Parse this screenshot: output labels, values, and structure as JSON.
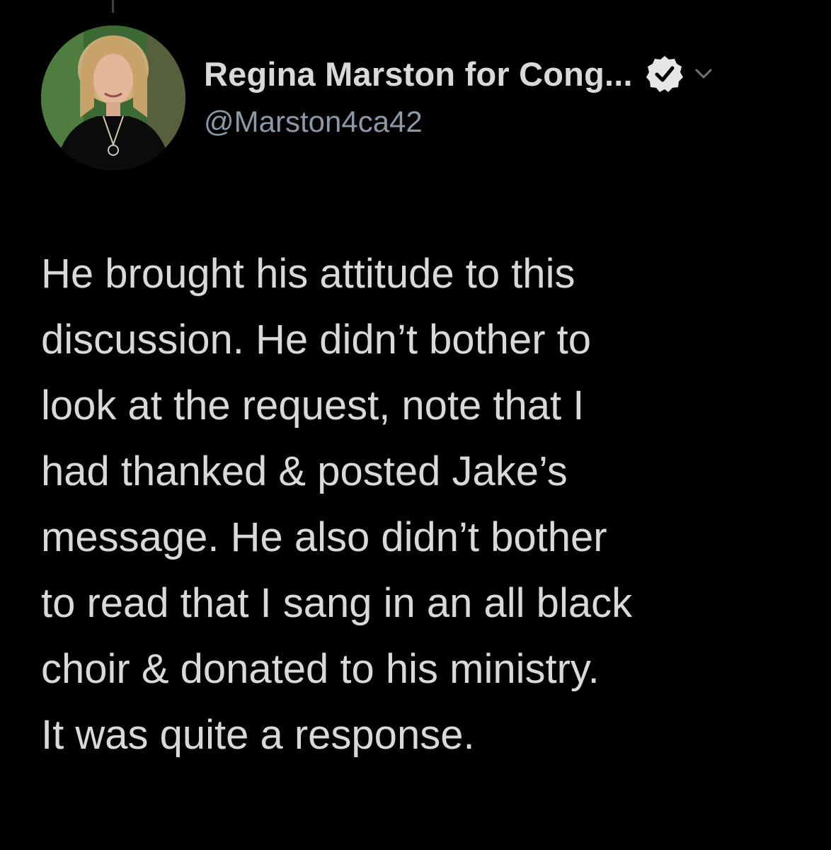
{
  "tweet": {
    "author": {
      "display_name": "Regina Marston for Cong...",
      "handle": "@Marston4ca42",
      "verified_icon": "verified-badge-icon",
      "menu_icon": "chevron-down-icon"
    },
    "text_lines": [
      "He brought his attitude to this",
      "discussion. He didn’t bother to",
      "look at the request, note that I",
      "had thanked & posted Jake’s",
      "message. He also didn’t bother",
      "to read that I sang in an all black",
      "choir & donated to his ministry.",
      "It was quite a response."
    ]
  },
  "theme": {
    "background": "#000000",
    "text": "#d9d9d9",
    "secondary_text": "#8b98a5"
  }
}
